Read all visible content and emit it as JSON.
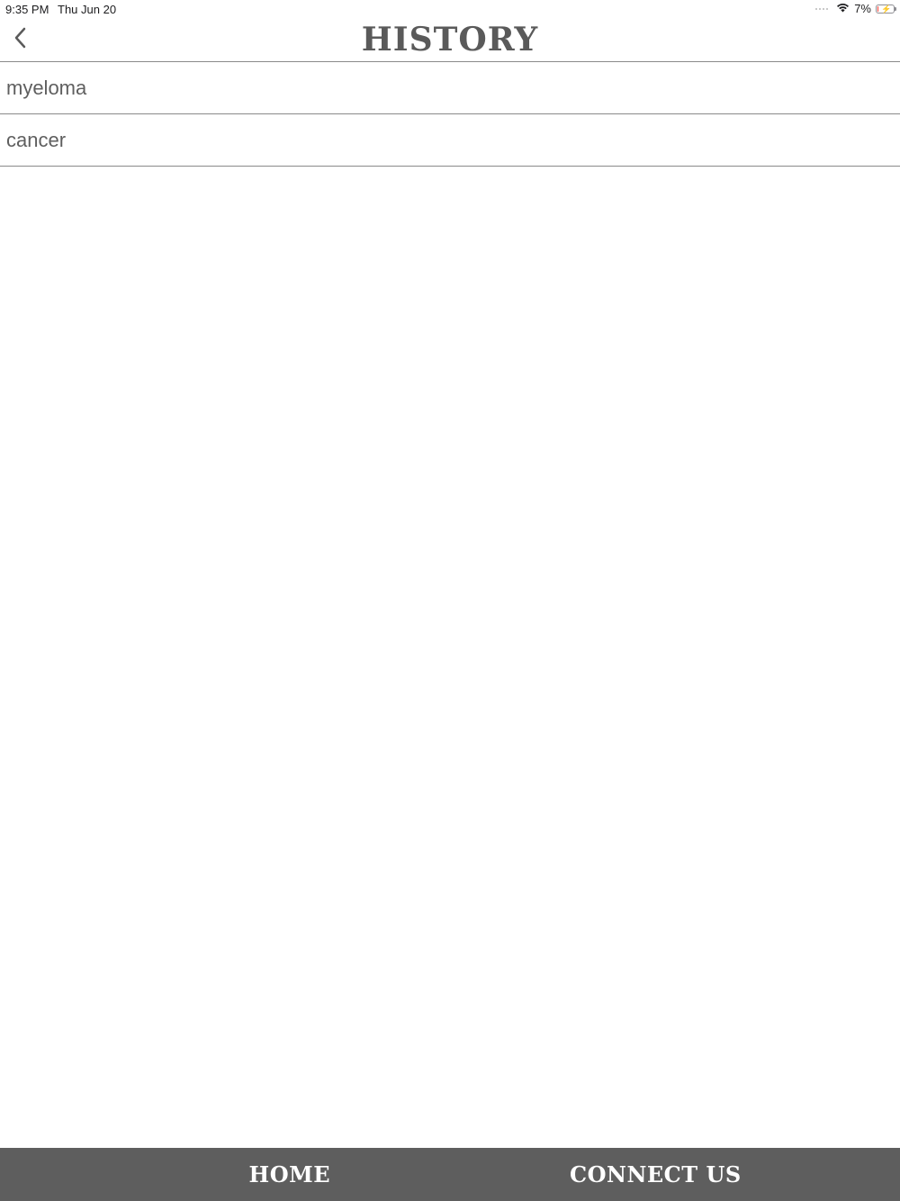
{
  "status_bar": {
    "time": "9:35 PM",
    "date": "Thu Jun 20",
    "battery_percent": "7%",
    "battery_level": 0.07,
    "battery_color": "#ff3b30",
    "icons": [
      "signal-dots-icon",
      "wifi-icon",
      "battery-icon",
      "charging-bolt-icon"
    ]
  },
  "nav": {
    "back_icon": "chevron-left-icon",
    "title": "HISTORY"
  },
  "history": {
    "items": [
      {
        "label": "myeloma"
      },
      {
        "label": "cancer"
      }
    ]
  },
  "tab_bar": {
    "background": "#5e5e5e",
    "home_label": "HOME",
    "connect_label": "CONNECT US"
  }
}
